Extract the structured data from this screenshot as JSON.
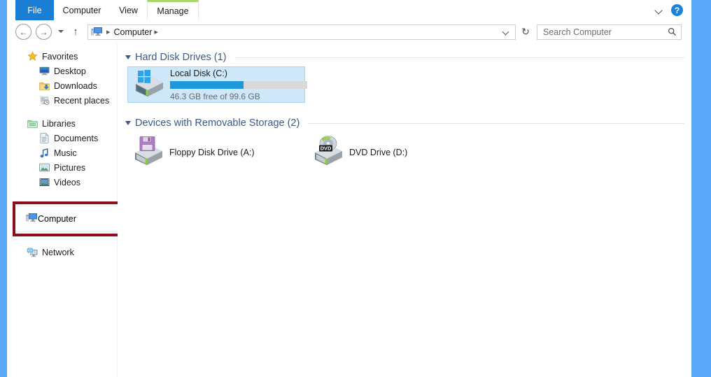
{
  "window": {
    "tabs": [
      {
        "id": "file",
        "label": "File"
      },
      {
        "id": "computer",
        "label": "Computer"
      },
      {
        "id": "view",
        "label": "View"
      },
      {
        "id": "manage",
        "label": "Manage"
      }
    ],
    "help_label": "?",
    "accent_file_tab": "#1a7fd4",
    "accent_manage_tab": "#a8d86a",
    "desktop_color": "#5aa9f8"
  },
  "navbar": {
    "back_glyph": "←",
    "forward_glyph": "→",
    "up_glyph": "↑",
    "refresh_glyph": "↻",
    "breadcrumb": {
      "icon": "computer-icon",
      "text": "Computer",
      "separator": "▸",
      "trailing_separator": "▸"
    }
  },
  "search": {
    "placeholder": "Search Computer",
    "value": "",
    "icon": "search-icon"
  },
  "sidebar": {
    "groups": [
      {
        "header": {
          "label": "Favorites",
          "icon": "star-icon"
        },
        "items": [
          {
            "label": "Desktop",
            "icon": "monitor-icon"
          },
          {
            "label": "Downloads",
            "icon": "download-folder-icon"
          },
          {
            "label": "Recent places",
            "icon": "recent-places-icon"
          }
        ]
      },
      {
        "header": {
          "label": "Libraries",
          "icon": "libraries-icon"
        },
        "items": [
          {
            "label": "Documents",
            "icon": "document-icon"
          },
          {
            "label": "Music",
            "icon": "music-note-icon"
          },
          {
            "label": "Pictures",
            "icon": "picture-icon"
          },
          {
            "label": "Videos",
            "icon": "film-icon"
          }
        ]
      }
    ],
    "computer": {
      "label": "Computer",
      "icon": "computer-icon",
      "highlighted": true
    },
    "network": {
      "label": "Network",
      "icon": "network-icon"
    },
    "annotation_color": "#8d0f1b"
  },
  "content": {
    "groups": [
      {
        "title": "Hard Disk Drives (1)",
        "items": [
          {
            "name": "Local Disk (C:)",
            "icon": "hard-drive-icon",
            "capacity_text": "46.3 GB free of 99.6 GB",
            "free_gb": 46.3,
            "total_gb": 99.6,
            "used_percent": 53.5,
            "meter_color": "#1e97d8",
            "selected": true
          }
        ]
      },
      {
        "title": "Devices with Removable Storage (2)",
        "items": [
          {
            "name": "Floppy Disk Drive (A:)",
            "icon": "floppy-drive-icon",
            "selected": false
          },
          {
            "name": "DVD Drive (D:)",
            "icon": "dvd-drive-icon",
            "selected": false
          }
        ]
      }
    ]
  }
}
